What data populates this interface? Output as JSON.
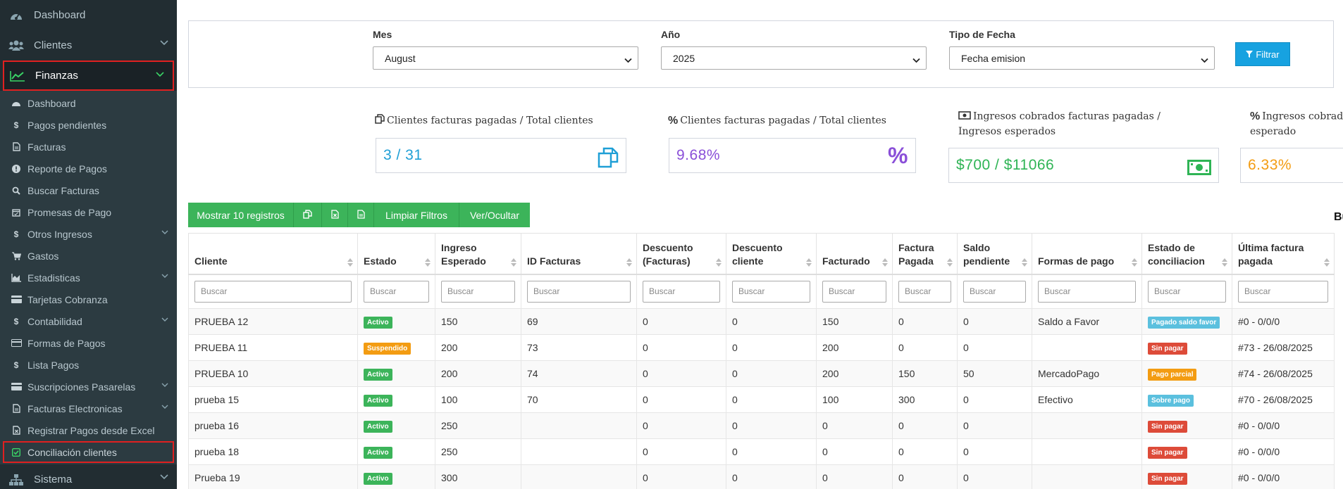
{
  "sidebar": {
    "top_items": [
      {
        "label": "Dashboard",
        "icon": "dashboard-icon"
      },
      {
        "label": "Clientes",
        "icon": "users-icon"
      },
      {
        "label": "Finanzas",
        "icon": "line-chart-icon"
      }
    ],
    "finanzas_items": [
      {
        "label": "Dashboard",
        "icon": "dashboard-icon"
      },
      {
        "label": "Pagos pendientes",
        "icon": "dollar-icon"
      },
      {
        "label": "Facturas",
        "icon": "file-icon"
      },
      {
        "label": "Reporte de Pagos",
        "icon": "info-icon"
      },
      {
        "label": "Buscar Facturas",
        "icon": "search-icon"
      },
      {
        "label": "Promesas de Pago",
        "icon": "calendar-icon"
      },
      {
        "label": "Otros Ingresos",
        "icon": "dollar-icon"
      },
      {
        "label": "Gastos",
        "icon": "cart-icon"
      },
      {
        "label": "Estadisticas",
        "icon": "area-chart-icon"
      },
      {
        "label": "Tarjetas Cobranza",
        "icon": "credit-card-icon"
      },
      {
        "label": "Contabilidad",
        "icon": "dollar-icon"
      },
      {
        "label": "Formas de Pagos",
        "icon": "credit-card-icon"
      },
      {
        "label": "Lista Pagos",
        "icon": "dollar-icon"
      },
      {
        "label": "Suscripciones Pasarelas",
        "icon": "credit-card-icon"
      },
      {
        "label": "Facturas Electronicas",
        "icon": "file-icon"
      },
      {
        "label": "Registrar Pagos desde Excel",
        "icon": "excel-file-icon"
      },
      {
        "label": "Conciliación clientes",
        "icon": "check-square-icon"
      }
    ],
    "bottom_item": {
      "label": "Sistema",
      "icon": "sitemap-icon"
    }
  },
  "filters": {
    "mes_label": "Mes",
    "mes_value": "August",
    "anio_label": "Año",
    "anio_value": "2025",
    "tipo_label": "Tipo de Fecha",
    "tipo_value": "Fecha emision",
    "filter_button": "Filtrar"
  },
  "kpis": [
    {
      "title": "Clientes facturas pagadas / Total clientes",
      "value": "3 / 31",
      "color": "#1f9fd6"
    },
    {
      "title": "Clientes facturas pagadas / Total clientes",
      "value": "9.68%",
      "color": "#8a4fd8"
    },
    {
      "title": "Ingresos cobrados facturas pagadas / Ingresos esperados",
      "value": "$700 / $11066",
      "color": "#2fb455"
    },
    {
      "title": "Ingresos cobrados facturas pagadas / Ingreso esperado",
      "value": "6.33%",
      "color": "#f39c12"
    }
  ],
  "toolbar": {
    "show_records": "Mostrar 10 registros",
    "clear_filters": "Limpiar Filtros",
    "show_hide": "Ver/Ocultar",
    "search_label": "Buscar:"
  },
  "table": {
    "search_placeholder": "Buscar",
    "headers": [
      "Cliente",
      "Estado",
      "Ingreso Esperado",
      "ID Facturas",
      "Descuento (Facturas)",
      "Descuento cliente",
      "Facturado",
      "Factura Pagada",
      "Saldo pendiente",
      "Formas de pago",
      "Estado de conciliacion",
      "Última factura pagada"
    ],
    "rows": [
      {
        "cliente": "PRUEBA 12",
        "estado": "Activo",
        "ingreso": "150",
        "id_facturas": "69",
        "desc_facturas": "0",
        "desc_cliente": "0",
        "facturado": "150",
        "pagada": "0",
        "saldo": "0",
        "formas": "Saldo a Favor",
        "conciliacion": "Pagado saldo favor",
        "ultima": "#0 - 0/0/0"
      },
      {
        "cliente": "PRUEBA 11",
        "estado": "Suspendido",
        "ingreso": "200",
        "id_facturas": "73",
        "desc_facturas": "0",
        "desc_cliente": "0",
        "facturado": "200",
        "pagada": "0",
        "saldo": "0",
        "formas": "",
        "conciliacion": "Sin pagar",
        "ultima": "#73 - 26/08/2025"
      },
      {
        "cliente": "PRUEBA 10",
        "estado": "Activo",
        "ingreso": "200",
        "id_facturas": "74",
        "desc_facturas": "0",
        "desc_cliente": "0",
        "facturado": "200",
        "pagada": "150",
        "saldo": "50",
        "formas": "MercadoPago",
        "conciliacion": "Pago parcial",
        "ultima": "#74 - 26/08/2025"
      },
      {
        "cliente": "prueba 15",
        "estado": "Activo",
        "ingreso": "100",
        "id_facturas": "70",
        "desc_facturas": "0",
        "desc_cliente": "0",
        "facturado": "100",
        "pagada": "300",
        "saldo": "0",
        "formas": "Efectivo",
        "conciliacion": "Sobre pago",
        "ultima": "#70 - 26/08/2025"
      },
      {
        "cliente": "prueba 16",
        "estado": "Activo",
        "ingreso": "250",
        "id_facturas": "",
        "desc_facturas": "0",
        "desc_cliente": "0",
        "facturado": "0",
        "pagada": "0",
        "saldo": "0",
        "formas": "",
        "conciliacion": "Sin pagar",
        "ultima": "#0 - 0/0/0"
      },
      {
        "cliente": "prueba 18",
        "estado": "Activo",
        "ingreso": "250",
        "id_facturas": "",
        "desc_facturas": "0",
        "desc_cliente": "0",
        "facturado": "0",
        "pagada": "0",
        "saldo": "0",
        "formas": "",
        "conciliacion": "Sin pagar",
        "ultima": "#0 - 0/0/0"
      },
      {
        "cliente": "Prueba 19",
        "estado": "Activo",
        "ingreso": "300",
        "id_facturas": "",
        "desc_facturas": "0",
        "desc_cliente": "0",
        "facturado": "0",
        "pagada": "0",
        "saldo": "0",
        "formas": "",
        "conciliacion": "Sin pagar",
        "ultima": "#0 - 0/0/0"
      }
    ]
  },
  "colors": {
    "sidebar_bg": "#222d32",
    "accent_green": "#3cb45a",
    "accent_blue": "#17a2e0",
    "highlight_red": "#e02020"
  }
}
